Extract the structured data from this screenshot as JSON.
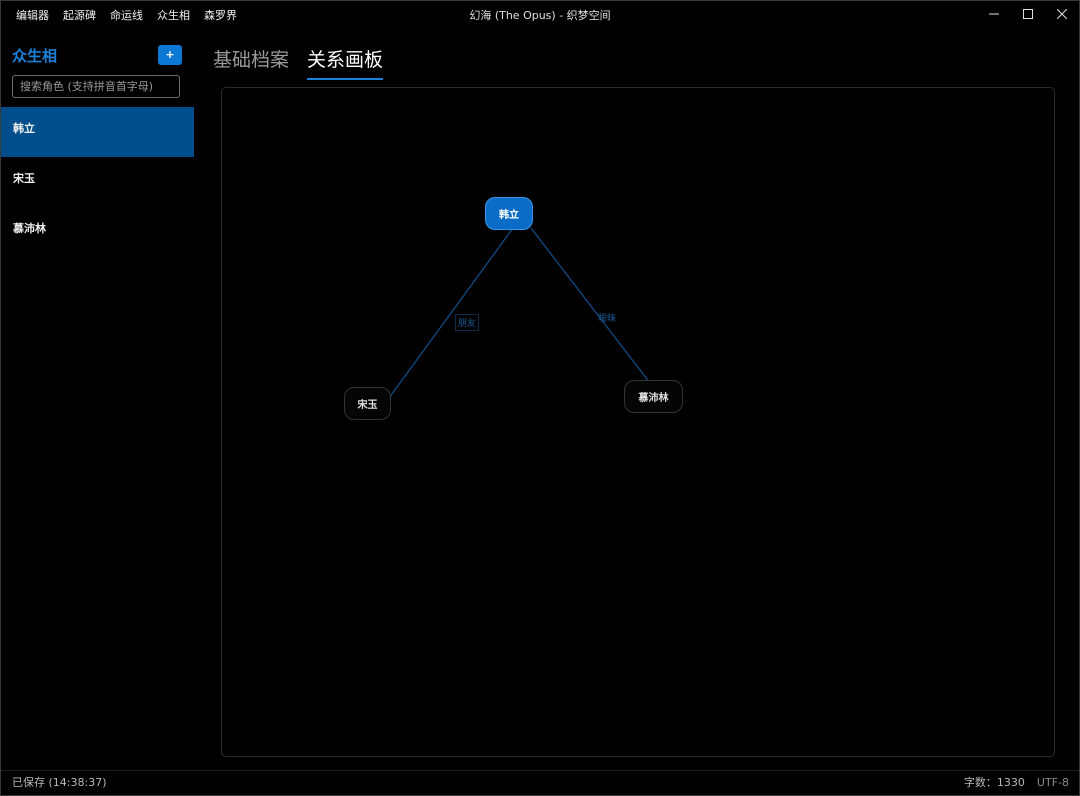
{
  "titlebar": {
    "menu": [
      "编辑器",
      "起源碑",
      "命运线",
      "众生相",
      "森罗界"
    ],
    "title": "幻海 (The Opus) - 织梦空间"
  },
  "sidebar": {
    "title": "众生相",
    "add_label": "+",
    "search_placeholder": "搜索角色 (支持拼音首字母)",
    "characters": [
      "韩立",
      "宋玉",
      "慕沛林"
    ],
    "selected": "韩立"
  },
  "main": {
    "tabs": [
      "基础档案",
      "关系画板"
    ],
    "active_tab": "关系画板"
  },
  "graph": {
    "nodes": {
      "center": "韩立",
      "left": "宋玉",
      "right": "慕沛林"
    },
    "edges": {
      "left_label": "朋友",
      "right_label": "暧昧"
    },
    "colors": {
      "center_node": "#0a6cc4",
      "edge": "#1a5a96"
    }
  },
  "statusbar": {
    "saved": "已保存 (14:38:37)",
    "word_count": "字数：1330",
    "encoding": "UTF-8"
  }
}
